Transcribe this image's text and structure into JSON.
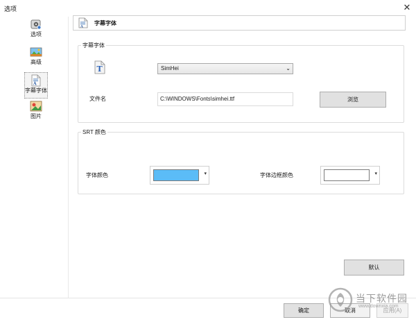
{
  "window": {
    "title": "选项"
  },
  "sidebar": {
    "items": [
      {
        "label": "选项",
        "icon": "options-icon"
      },
      {
        "label": "高级",
        "icon": "advanced-icon"
      },
      {
        "label": "字幕字体",
        "icon": "subtitle-font-icon",
        "selected": true
      },
      {
        "label": "图片",
        "icon": "picture-icon"
      }
    ]
  },
  "header": {
    "title": "字幕字体"
  },
  "font_group": {
    "legend": "字幕字体",
    "font_select_value": "SimHei",
    "file_label": "文件名",
    "file_path": "C:\\WINDOWS\\Fonts\\simhei.ttf",
    "browse_label": "浏览"
  },
  "srt_group": {
    "legend": "SRT 颜色",
    "font_color_label": "字体颜色",
    "border_color_label": "字体边框颜色",
    "font_color": "#5bbcf7",
    "border_color": "#ffffff"
  },
  "buttons": {
    "default_label": "默认",
    "ok_label": "确定",
    "cancel_label": "取消",
    "apply_label": "应用(A)"
  },
  "watermark": {
    "text": "当下软件园",
    "url": "www.downxia.com"
  }
}
